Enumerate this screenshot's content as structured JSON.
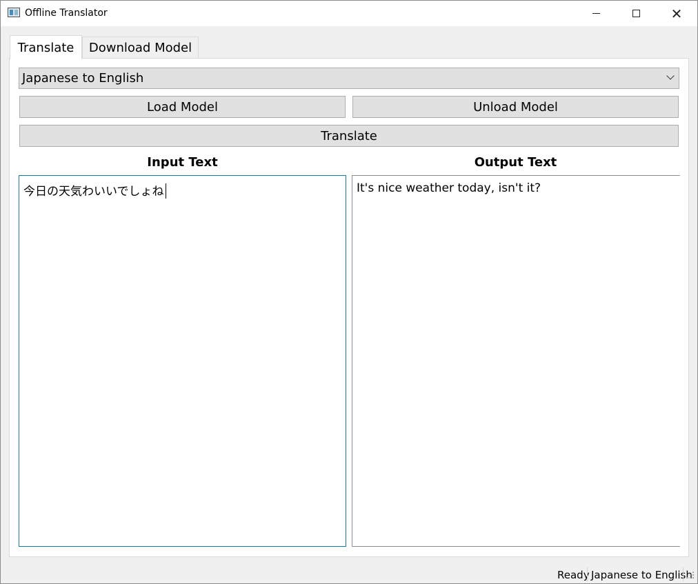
{
  "window": {
    "title": "Offline Translator",
    "icon": "app-icon",
    "controls": [
      "minimize-icon",
      "maximize-icon",
      "close-icon"
    ]
  },
  "tabs": [
    {
      "label": "Translate",
      "active": true
    },
    {
      "label": "Download Model",
      "active": false
    }
  ],
  "translate": {
    "language_pair": "Japanese to English",
    "load_label": "Load Model",
    "unload_label": "Unload Model",
    "translate_label": "Translate",
    "input_label": "Input Text",
    "output_label": "Output Text",
    "input_value": "今日の天気わいいでしょね",
    "output_value": "It's nice weather today, isn't it?"
  },
  "status": {
    "state": "Ready",
    "language_pair": "Japanese to English"
  },
  "colors": {
    "focus_border": "#0f7aa8",
    "button_bg": "#e1e1e1",
    "window_bg": "#f0f0f0"
  }
}
